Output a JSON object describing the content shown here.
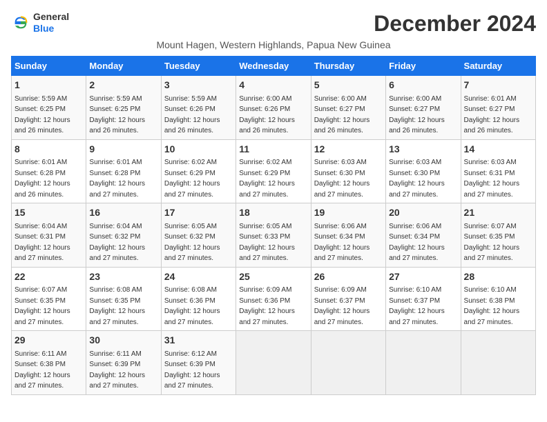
{
  "logo": {
    "general": "General",
    "blue": "Blue"
  },
  "title": "December 2024",
  "location": "Mount Hagen, Western Highlands, Papua New Guinea",
  "days_header": [
    "Sunday",
    "Monday",
    "Tuesday",
    "Wednesday",
    "Thursday",
    "Friday",
    "Saturday"
  ],
  "weeks": [
    [
      {
        "day": "1",
        "sunrise": "5:59 AM",
        "sunset": "6:25 PM",
        "daylight": "12 hours and 26 minutes."
      },
      {
        "day": "2",
        "sunrise": "5:59 AM",
        "sunset": "6:25 PM",
        "daylight": "12 hours and 26 minutes."
      },
      {
        "day": "3",
        "sunrise": "5:59 AM",
        "sunset": "6:26 PM",
        "daylight": "12 hours and 26 minutes."
      },
      {
        "day": "4",
        "sunrise": "6:00 AM",
        "sunset": "6:26 PM",
        "daylight": "12 hours and 26 minutes."
      },
      {
        "day": "5",
        "sunrise": "6:00 AM",
        "sunset": "6:27 PM",
        "daylight": "12 hours and 26 minutes."
      },
      {
        "day": "6",
        "sunrise": "6:00 AM",
        "sunset": "6:27 PM",
        "daylight": "12 hours and 26 minutes."
      },
      {
        "day": "7",
        "sunrise": "6:01 AM",
        "sunset": "6:27 PM",
        "daylight": "12 hours and 26 minutes."
      }
    ],
    [
      {
        "day": "8",
        "sunrise": "6:01 AM",
        "sunset": "6:28 PM",
        "daylight": "12 hours and 26 minutes."
      },
      {
        "day": "9",
        "sunrise": "6:01 AM",
        "sunset": "6:28 PM",
        "daylight": "12 hours and 27 minutes."
      },
      {
        "day": "10",
        "sunrise": "6:02 AM",
        "sunset": "6:29 PM",
        "daylight": "12 hours and 27 minutes."
      },
      {
        "day": "11",
        "sunrise": "6:02 AM",
        "sunset": "6:29 PM",
        "daylight": "12 hours and 27 minutes."
      },
      {
        "day": "12",
        "sunrise": "6:03 AM",
        "sunset": "6:30 PM",
        "daylight": "12 hours and 27 minutes."
      },
      {
        "day": "13",
        "sunrise": "6:03 AM",
        "sunset": "6:30 PM",
        "daylight": "12 hours and 27 minutes."
      },
      {
        "day": "14",
        "sunrise": "6:03 AM",
        "sunset": "6:31 PM",
        "daylight": "12 hours and 27 minutes."
      }
    ],
    [
      {
        "day": "15",
        "sunrise": "6:04 AM",
        "sunset": "6:31 PM",
        "daylight": "12 hours and 27 minutes."
      },
      {
        "day": "16",
        "sunrise": "6:04 AM",
        "sunset": "6:32 PM",
        "daylight": "12 hours and 27 minutes."
      },
      {
        "day": "17",
        "sunrise": "6:05 AM",
        "sunset": "6:32 PM",
        "daylight": "12 hours and 27 minutes."
      },
      {
        "day": "18",
        "sunrise": "6:05 AM",
        "sunset": "6:33 PM",
        "daylight": "12 hours and 27 minutes."
      },
      {
        "day": "19",
        "sunrise": "6:06 AM",
        "sunset": "6:34 PM",
        "daylight": "12 hours and 27 minutes."
      },
      {
        "day": "20",
        "sunrise": "6:06 AM",
        "sunset": "6:34 PM",
        "daylight": "12 hours and 27 minutes."
      },
      {
        "day": "21",
        "sunrise": "6:07 AM",
        "sunset": "6:35 PM",
        "daylight": "12 hours and 27 minutes."
      }
    ],
    [
      {
        "day": "22",
        "sunrise": "6:07 AM",
        "sunset": "6:35 PM",
        "daylight": "12 hours and 27 minutes."
      },
      {
        "day": "23",
        "sunrise": "6:08 AM",
        "sunset": "6:35 PM",
        "daylight": "12 hours and 27 minutes."
      },
      {
        "day": "24",
        "sunrise": "6:08 AM",
        "sunset": "6:36 PM",
        "daylight": "12 hours and 27 minutes."
      },
      {
        "day": "25",
        "sunrise": "6:09 AM",
        "sunset": "6:36 PM",
        "daylight": "12 hours and 27 minutes."
      },
      {
        "day": "26",
        "sunrise": "6:09 AM",
        "sunset": "6:37 PM",
        "daylight": "12 hours and 27 minutes."
      },
      {
        "day": "27",
        "sunrise": "6:10 AM",
        "sunset": "6:37 PM",
        "daylight": "12 hours and 27 minutes."
      },
      {
        "day": "28",
        "sunrise": "6:10 AM",
        "sunset": "6:38 PM",
        "daylight": "12 hours and 27 minutes."
      }
    ],
    [
      {
        "day": "29",
        "sunrise": "6:11 AM",
        "sunset": "6:38 PM",
        "daylight": "12 hours and 27 minutes."
      },
      {
        "day": "30",
        "sunrise": "6:11 AM",
        "sunset": "6:39 PM",
        "daylight": "12 hours and 27 minutes."
      },
      {
        "day": "31",
        "sunrise": "6:12 AM",
        "sunset": "6:39 PM",
        "daylight": "12 hours and 27 minutes."
      },
      null,
      null,
      null,
      null
    ]
  ],
  "labels": {
    "sunrise": "Sunrise: ",
    "sunset": "Sunset: ",
    "daylight": "Daylight: "
  }
}
